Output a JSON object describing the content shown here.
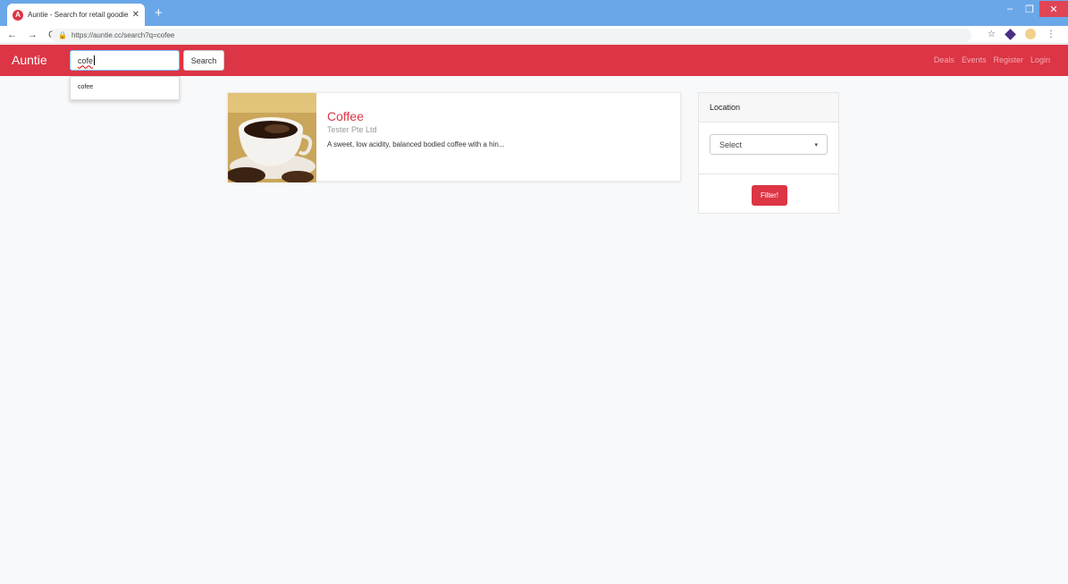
{
  "browser": {
    "tab_title": "Auntie - Search for retail goodies",
    "tab_close": "✕",
    "favicon_letter": "A",
    "new_tab": "+",
    "url": "https://auntie.cc/search?q=cofee",
    "back": "←",
    "forward": "→",
    "reload": "C",
    "lock": "🔒",
    "star": "☆",
    "menu": "⋮",
    "minimize": "–",
    "restore": "❐",
    "close": "✕"
  },
  "navbar": {
    "brand": "Auntie",
    "search_value": "cofe",
    "search_button": "Search",
    "links": [
      "Deals",
      "Events",
      "Register",
      "Login"
    ]
  },
  "autocomplete": {
    "suggestion": "cofee"
  },
  "result": {
    "title": "Coffee",
    "vendor": "Tester Pte Ltd",
    "description": "A sweet, low acidity, balanced bodied coffee with a hin..."
  },
  "filter": {
    "heading": "Location",
    "select_value": "Select",
    "select_arrow": "▾",
    "button": "Filter!"
  },
  "colors": {
    "brand_red": "#dc3545",
    "tabstrip_blue": "#6aa7e8"
  }
}
